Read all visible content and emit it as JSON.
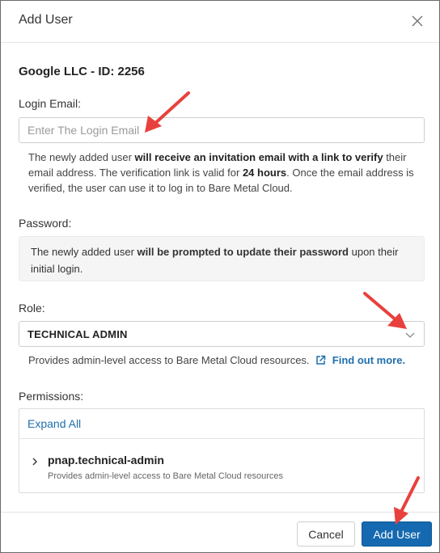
{
  "dialog": {
    "title": "Add User",
    "company": "Google LLC - ID: 2256"
  },
  "login_email": {
    "label": "Login Email:",
    "placeholder": "Enter The Login Email",
    "help_1": "The newly added user ",
    "help_2": "will receive an invitation email with a link to verify",
    "help_3": " their email address. The verification link is valid for ",
    "help_4": "24 hours",
    "help_5": ". Once the email address is verified, the user can use it to log in to Bare Metal Cloud."
  },
  "password": {
    "label": "Password:",
    "info_1": "The newly added user ",
    "info_2": "will be prompted to update their password",
    "info_3": " upon their initial login."
  },
  "role": {
    "label": "Role:",
    "selected": "TECHNICAL ADMIN",
    "help": "Provides admin-level access to Bare Metal Cloud resources.",
    "link": "Find out more."
  },
  "permissions": {
    "label": "Permissions:",
    "expand_all": "Expand All",
    "items": [
      {
        "name": "pnap.technical-admin",
        "description": "Provides admin-level access to Bare Metal Cloud resources"
      }
    ]
  },
  "footer": {
    "cancel": "Cancel",
    "add_user": "Add User"
  },
  "colors": {
    "primary_button": "#1569b0",
    "link": "#1f6fae",
    "annotation_arrow": "#e8413d"
  },
  "icons": [
    "close-icon",
    "chevron-down-icon",
    "external-link-icon",
    "caret-right-icon"
  ]
}
